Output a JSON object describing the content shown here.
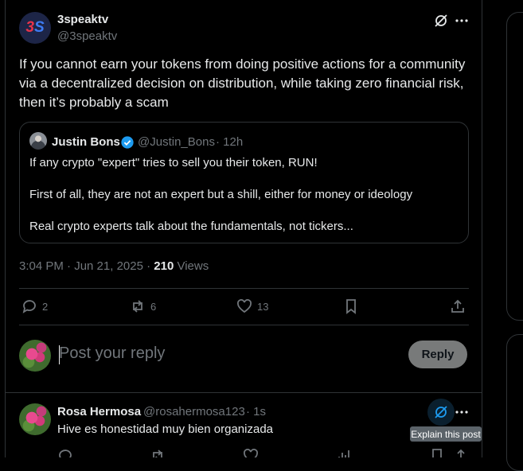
{
  "tweet": {
    "author_name": "3speaktv",
    "author_handle": "@3speaktv",
    "avatar_text_a": "3",
    "avatar_text_b": "S",
    "text": "If you cannot earn your tokens from doing positive actions for a community via a decentralized decision on distribution, while taking zero financial risk, then it’s probably a scam",
    "time": "3:04 PM · Jun 21, 2025 · ",
    "views_count": "210",
    "views_label": " Views",
    "stats": {
      "replies": "2",
      "reposts": "6",
      "likes": "13"
    }
  },
  "quote": {
    "author_name": "Justin Bons",
    "author_handle": "@Justin_Bons",
    "age": "· 12h",
    "line1": "If any crypto \"expert\" tries to sell you their token, RUN!",
    "line2": "First of all, they are not an expert but a shill, either for money or ideology",
    "line3": "Real crypto experts talk about the fundamentals, not tickers..."
  },
  "composer": {
    "placeholder": "Post your reply",
    "button": "Reply"
  },
  "reply": {
    "author_name": "Rosa Hermosa",
    "author_handle": "@rosahermosa123",
    "age": "· 1s",
    "text": "Hive es honestidad muy bien organizada",
    "tooltip": "Explain this post"
  },
  "colors": {
    "background": "#000000",
    "text": "#e7e9ea",
    "muted": "#71767b",
    "accent": "#1d9bf0",
    "border": "#2f3336"
  },
  "icons": [
    "grok-icon",
    "more-icon",
    "verified-icon",
    "reply-icon",
    "repost-icon",
    "like-icon",
    "bookmark-icon",
    "share-icon",
    "views-icon"
  ]
}
